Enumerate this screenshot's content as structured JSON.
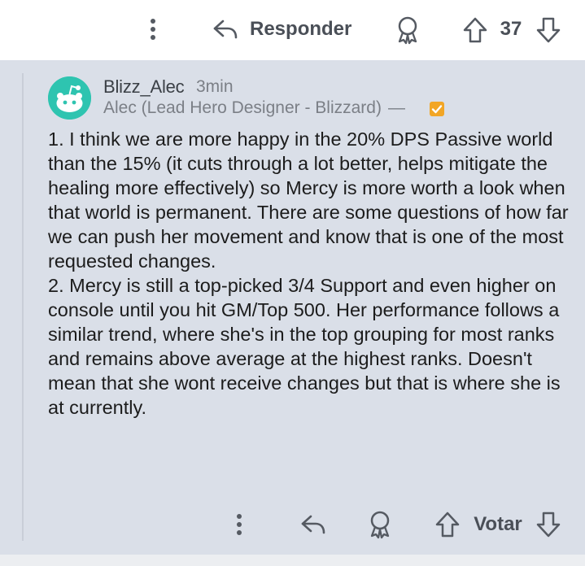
{
  "top_actions": {
    "reply_label": "Responder",
    "vote_count": "37"
  },
  "comment": {
    "username": "Blizz_Alec",
    "time": "3min",
    "flair": "Alec (Lead Hero Designer - Blizzard)",
    "flair_separator": "—",
    "paragraphs": [
      "1. I think we are more happy in the 20% DPS Passive world than the 15% (it cuts through a lot better, helps mitigate the healing more effectively) so Mercy is more worth a look when that world is permanent. There are some questions of how far we can push her movement and know that is one of the most requested changes.",
      "2. Mercy is still a top-picked 3/4 Support and even higher on console until you hit GM/Top 500. Her performance follows a similar trend, where she's in the top grouping for most ranks and remains above average at the highest ranks. Doesn't mean that she wont receive changes but that is where she is at currently."
    ]
  },
  "bottom_actions": {
    "vote_label": "Votar"
  },
  "icons": [
    "more-vert-icon",
    "reply-icon",
    "award-icon",
    "upvote-icon",
    "downvote-icon",
    "flair-badge-icon",
    "avatar-icon"
  ],
  "colors": {
    "avatar": "#2ec4b0",
    "badge": "#f2a626",
    "comment_bg": "#dadfe8"
  }
}
